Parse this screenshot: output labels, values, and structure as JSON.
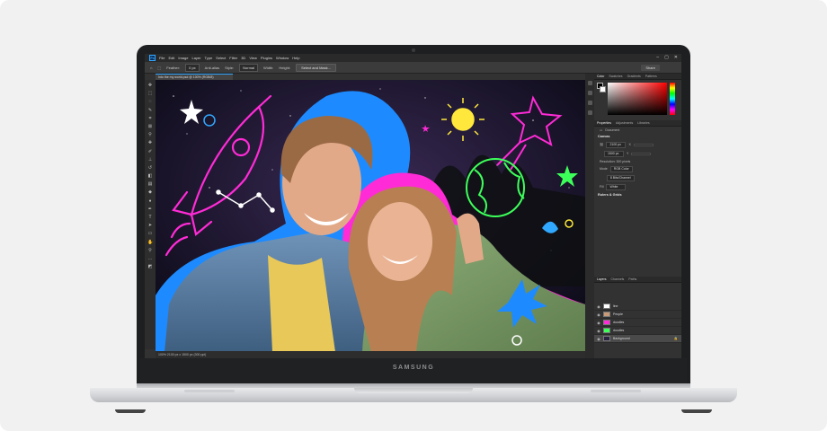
{
  "device": {
    "brand": "SAMSUNG"
  },
  "app": {
    "menu": [
      "File",
      "Edit",
      "Image",
      "Layer",
      "Type",
      "Select",
      "Filter",
      "3D",
      "View",
      "Plugins",
      "Window",
      "Help"
    ],
    "options_bar": {
      "feather_label": "Feather:",
      "feather_value": "0 px",
      "anti_alias": "Anti-alias",
      "style_label": "Style:",
      "style_value": "Normal",
      "width_label": "Width:",
      "height_label": "Height:",
      "select_mask_button": "Select and Mask...",
      "share_button": "Share"
    },
    "document_tab": "Into the my world.psd @ 100% (RGB/8)",
    "status_bar": "100%    2100 px x 1500 px (300 ppi)"
  },
  "panels": {
    "color_tabs": [
      "Color",
      "Swatches",
      "Gradients",
      "Patterns"
    ],
    "properties_tabs": [
      "Properties",
      "Adjustments",
      "Libraries"
    ],
    "document_label": "Document",
    "canvas_header": "Canvas",
    "canvas_width": "2100 px",
    "canvas_height": "1500 px",
    "x_label": "X",
    "y_label": "Y",
    "resolution": "Resolution: 300 pixels",
    "mode_label": "Mode",
    "mode_value": "RGB Color",
    "bits_value": "8 Bits/Channel",
    "fill_label": "Fill",
    "fill_value": "White",
    "rulers_header": "Rulers & Grids",
    "layers_tabs": [
      "Layers",
      "Channels",
      "Paths"
    ],
    "layers": [
      {
        "name": "line",
        "selected": false
      },
      {
        "name": "People",
        "selected": false
      },
      {
        "name": "doodles",
        "selected": false
      },
      {
        "name": "doodles",
        "selected": false
      },
      {
        "name": "Background",
        "selected": true
      }
    ]
  },
  "colors": {
    "accent": "#31a8ff",
    "neon_pink": "#ff2bd6",
    "neon_green": "#3dff5a",
    "neon_yellow": "#ffe83b",
    "outline_blue": "#1d8bff"
  }
}
